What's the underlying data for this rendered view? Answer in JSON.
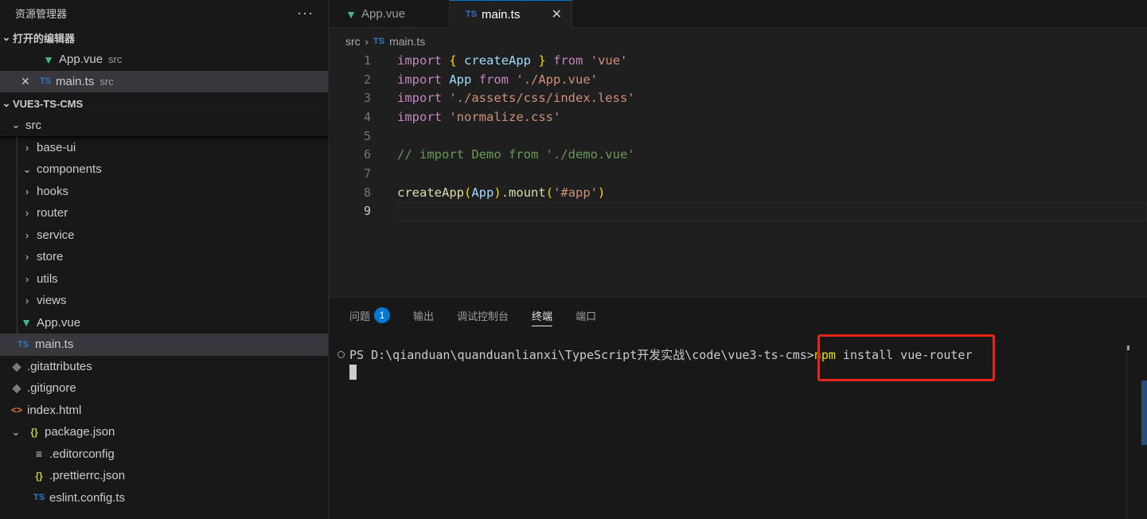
{
  "sidebar": {
    "title": "资源管理器",
    "more": "···",
    "open_editors": {
      "title": "打开的编辑器",
      "items": [
        {
          "icon": "vue-icon",
          "name": "App.vue",
          "path": "src"
        },
        {
          "icon": "ts-icon",
          "name": "main.ts",
          "path": "src",
          "close": "✕"
        }
      ]
    },
    "project": {
      "title": "VUE3-TS-CMS",
      "src": "src",
      "folders": [
        "base-ui",
        "components",
        "hooks",
        "router",
        "service",
        "store",
        "utils",
        "views"
      ],
      "src_files": [
        "App.vue",
        "main.ts"
      ],
      "root_files": [
        ".gitattributes",
        ".gitignore",
        "index.html",
        "package.json"
      ],
      "nested_files": [
        ".editorconfig",
        ".prettierrc.json",
        "eslint.config.ts"
      ]
    }
  },
  "tabs": [
    {
      "label": "App.vue",
      "active": false
    },
    {
      "label": "main.ts",
      "active": true,
      "close": "✕"
    }
  ],
  "breadcrumb": {
    "folder": "src",
    "file": "main.ts"
  },
  "editor": {
    "line_numbers": [
      "1",
      "2",
      "3",
      "4",
      "5",
      "6",
      "7",
      "8",
      "9"
    ],
    "current_line": "9"
  },
  "panel": {
    "tabs": [
      {
        "label": "问题",
        "badge": "1"
      },
      {
        "label": "输出"
      },
      {
        "label": "调试控制台"
      },
      {
        "label": "终端",
        "active": true
      },
      {
        "label": "端口"
      }
    ],
    "terminal": {
      "prompt": "PS D:\\qianduan\\quanduanlianxi\\TypeScript开发实战\\code\\vue3-ts-cms>",
      "command_npm": "npm",
      "command_rest": " install vue-router"
    }
  },
  "colors": {
    "accent": "#0078d4",
    "highlight_box": "#e8231c"
  }
}
